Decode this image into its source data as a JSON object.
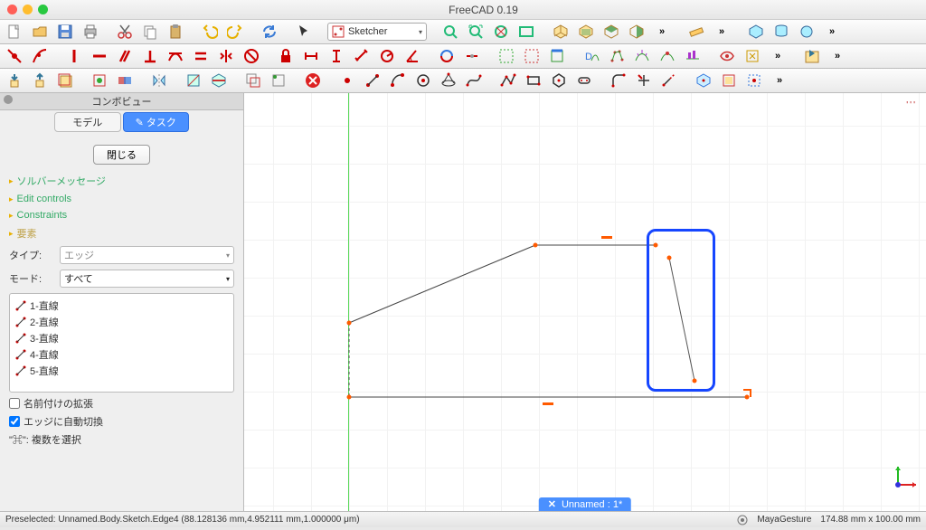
{
  "title": "FreeCAD 0.19",
  "workbench": {
    "label": "Sketcher"
  },
  "combo": {
    "title": "コンボビュー",
    "tabs": {
      "model": "モデル",
      "task": "タスク"
    },
    "close": "閉じる",
    "sections": {
      "solver": "ソルバーメッセージ",
      "edit": "Edit controls",
      "constraints": "Constraints",
      "elements": "要素"
    },
    "typeLabel": "タイプ:",
    "typeValue": "エッジ",
    "modeLabel": "モード:",
    "modeValue": "すべて",
    "list": [
      "1-直線",
      "2-直線",
      "3-直線",
      "4-直線",
      "5-直線"
    ],
    "chkNaming": "名前付けの拡張",
    "chkAutoSwitch": "エッジに自動切換",
    "hint": "\"⌘\": 複数を選択"
  },
  "doc_tab": "Unnamed : 1*",
  "status": {
    "preselect": "Preselected: Unnamed.Body.Sketch.Edge4 (88.128136 mm,4.952111 mm,1.000000 μm)",
    "nav": "MayaGesture",
    "dims": "174.88 mm x 100.00 mm"
  },
  "coord_label": "'''"
}
